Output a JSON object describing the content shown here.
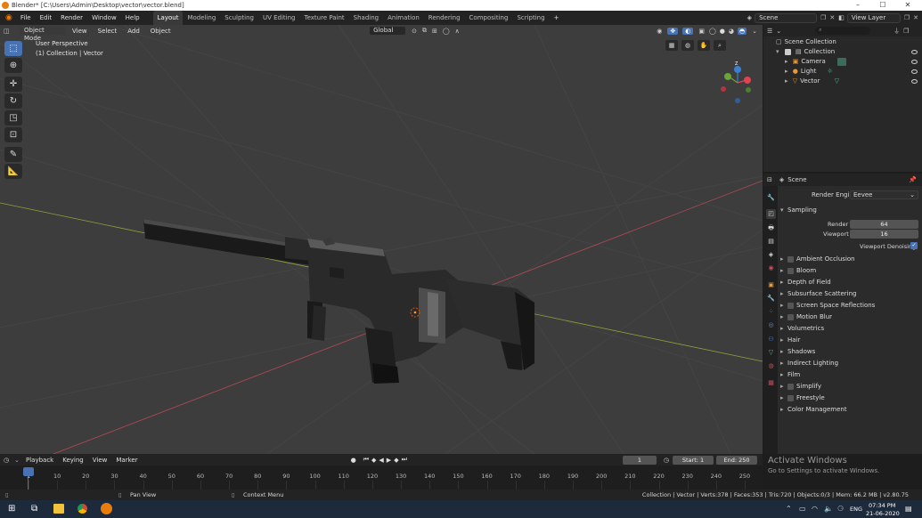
{
  "window": {
    "title": "Blender* [C:\\Users\\Admin\\Desktop\\vector\\vector.blend]"
  },
  "menu": [
    "File",
    "Edit",
    "Render",
    "Window",
    "Help"
  ],
  "workspaces": [
    "Layout",
    "Modeling",
    "Sculpting",
    "UV Editing",
    "Texture Paint",
    "Shading",
    "Animation",
    "Rendering",
    "Compositing",
    "Scripting"
  ],
  "active_workspace": "Layout",
  "scene_name": "Scene",
  "view_layer": "View Layer",
  "viewport": {
    "mode": "Object Mode",
    "menus": [
      "View",
      "Select",
      "Add",
      "Object"
    ],
    "orientation": "Global",
    "overlay_title": "User Perspective",
    "overlay_sub": "(1) Collection | Vector",
    "gizmo": {
      "z": "Z",
      "y": "Y",
      "x": "X"
    }
  },
  "outliner": {
    "root": "Scene Collection",
    "items": [
      {
        "label": "Collection"
      },
      {
        "label": "Camera"
      },
      {
        "label": "Light"
      },
      {
        "label": "Vector"
      }
    ]
  },
  "properties": {
    "context": "Scene",
    "render_engine_label": "Render Engine",
    "render_engine": "Eevee",
    "sampling_title": "Sampling",
    "render_label": "Render",
    "render_value": "64",
    "viewport_label": "Viewport",
    "viewport_value": "16",
    "denoise_label": "Viewport Denoising",
    "sections": [
      {
        "label": "Ambient Occlusion",
        "checkbox": true
      },
      {
        "label": "Bloom",
        "checkbox": true
      },
      {
        "label": "Depth of Field",
        "checkbox": false
      },
      {
        "label": "Subsurface Scattering",
        "checkbox": false
      },
      {
        "label": "Screen Space Reflections",
        "checkbox": true
      },
      {
        "label": "Motion Blur",
        "checkbox": true
      },
      {
        "label": "Volumetrics",
        "checkbox": false
      },
      {
        "label": "Hair",
        "checkbox": false
      },
      {
        "label": "Shadows",
        "checkbox": false
      },
      {
        "label": "Indirect Lighting",
        "checkbox": false
      },
      {
        "label": "Film",
        "checkbox": false
      },
      {
        "label": "Simplify",
        "checkbox": true
      },
      {
        "label": "Freestyle",
        "checkbox": true
      },
      {
        "label": "Color Management",
        "checkbox": false
      }
    ]
  },
  "timeline": {
    "menus": [
      "Playback",
      "Keying",
      "View",
      "Marker"
    ],
    "current_frame": "1",
    "start_label": "Start:",
    "start": "1",
    "end_label": "End:",
    "end": "250",
    "ticks": [
      "1",
      "10",
      "20",
      "30",
      "40",
      "50",
      "60",
      "70",
      "80",
      "90",
      "100",
      "110",
      "120",
      "130",
      "140",
      "150",
      "160",
      "170",
      "180",
      "190",
      "200",
      "210",
      "220",
      "230",
      "240",
      "250"
    ]
  },
  "status": {
    "pan": "Pan View",
    "context": "Context Menu",
    "stats": "Collection | Vector | Verts:378 | Faces:353 | Tris:720 | Objects:0/3 | Mem: 66.2 MB | v2.80.75"
  },
  "watermark": {
    "title": "Activate Windows",
    "sub": "Go to Settings to activate Windows."
  },
  "taskbar": {
    "lang": "ENG",
    "time": "07:34 PM",
    "date": "21-06-2020"
  },
  "colors": {
    "accent": "#4772b3",
    "viewport_bg": "#3d3d3d",
    "x_axis": "#b44a55",
    "y_axis": "#8da23a",
    "gizmo_x": "#e0434f",
    "gizmo_y": "#6aa43a",
    "gizmo_z": "#3b7fd1"
  }
}
